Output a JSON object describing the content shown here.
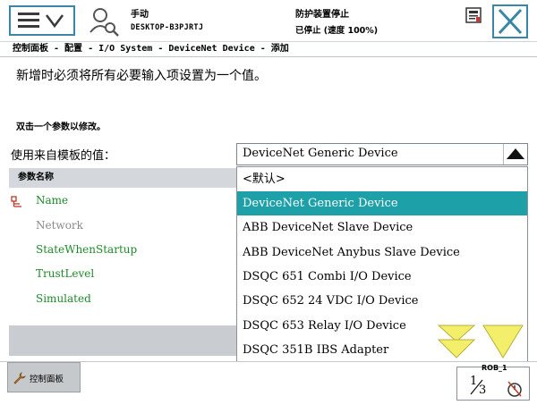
{
  "header": {
    "mode": "手动",
    "host": "DESKTOP-B3PJRTJ",
    "guard_status": "防护装置停止",
    "speed_status": "已停止 (速度 100%)"
  },
  "breadcrumb": "控制面板 - 配置 - I/O System - DeviceNet Device - 添加",
  "instruction": "新增时必须将所有必要输入项设置为一个值。",
  "hint": "双击一个参数以修改。",
  "template": {
    "label": "使用来自模板的值：",
    "value": "DeviceNet Generic Device"
  },
  "params": {
    "header": "参数名称",
    "items": [
      "Name",
      "Network",
      "StateWhenStartup",
      "TrustLevel",
      "Simulated"
    ]
  },
  "options": [
    "<默认>",
    "DeviceNet Generic Device",
    "ABB DeviceNet Slave Device",
    "ABB DeviceNet Anybus Slave Device",
    "DSQC 651 Combi I/O Device",
    "DSQC 652 24 VDC I/O Device",
    "DSQC 653 Relay I/O Device",
    "DSQC 351B IBS Adapter"
  ],
  "selected_option_index": 1,
  "taskbar": {
    "control_panel": "控制面板",
    "robot": "ROB_1",
    "fraction_top": "1",
    "fraction_bottom": "3"
  },
  "colors": {
    "accent": "#3a86a6",
    "selection": "#1ea0a8",
    "param_green": "#1e8a2a",
    "param_gray": "#8a8a8a",
    "arrow_yellow": "#f3ef6a"
  },
  "icons": {
    "menu": "hamburger-chevron-icon",
    "user": "user-magnifier-icon",
    "log": "event-log-icon",
    "close": "close-icon",
    "dropdown": "triangle-up-icon",
    "scroll": "double-down-arrow-icon",
    "control_panel": "wrench-icon",
    "quickset": "quickset-icon"
  }
}
